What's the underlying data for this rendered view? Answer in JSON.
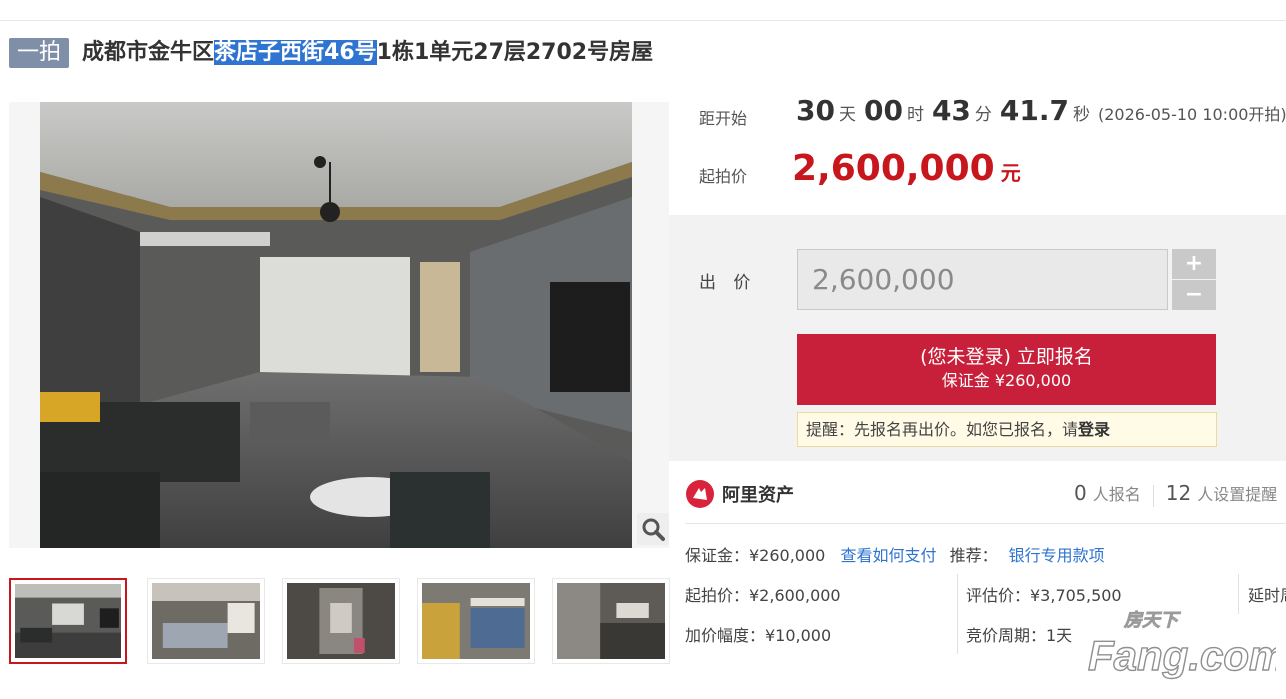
{
  "title": {
    "badge": "一拍",
    "prefix": "成都市金牛区",
    "highlighted": "茶店子西街46号",
    "suffix": "1栋1单元27层2702号房屋"
  },
  "countdown": {
    "label": "距开始",
    "days": "30",
    "days_unit": "天",
    "hours": "00",
    "hours_unit": "时",
    "minutes": "43",
    "minutes_unit": "分",
    "seconds": "41.7",
    "seconds_unit": "秒",
    "note": "(2026-05-10 10:00开拍)"
  },
  "start_price": {
    "label": "起拍价",
    "value": "2,600,000",
    "unit": "元"
  },
  "bid": {
    "label": "出 价",
    "input_value": "2,600,000",
    "plus": "+",
    "minus": "−"
  },
  "signup": {
    "line1": "(您未登录) 立即报名",
    "line2": "保证金 ¥260,000"
  },
  "reminder": {
    "text": "提醒：先报名再出价。如您已报名，请",
    "link": "登录"
  },
  "provider": {
    "name": "阿里资产"
  },
  "stats": {
    "signups": "0",
    "signups_label": "人报名",
    "reminders": "12",
    "reminders_label": "人设置提醒"
  },
  "info": {
    "deposit": "保证金：¥260,000",
    "how_to_pay": "查看如何支付",
    "recommend_label": "推荐：",
    "recommend_link": "银行专用款项",
    "start_price": "起拍价：¥2,600,000",
    "appraisal": "评估价：¥3,705,500",
    "delay": "延时周期",
    "increment": "加价幅度：¥10,000",
    "bid_cycle": "竞价周期：1天"
  },
  "watermark": {
    "brand": "Fang.com",
    "cn": "房天下"
  },
  "colors": {
    "accent": "#c8203a",
    "price": "#c8161d",
    "link": "#2f74d0",
    "badge": "#7f8fa8",
    "highlight": "#2f74d0"
  }
}
